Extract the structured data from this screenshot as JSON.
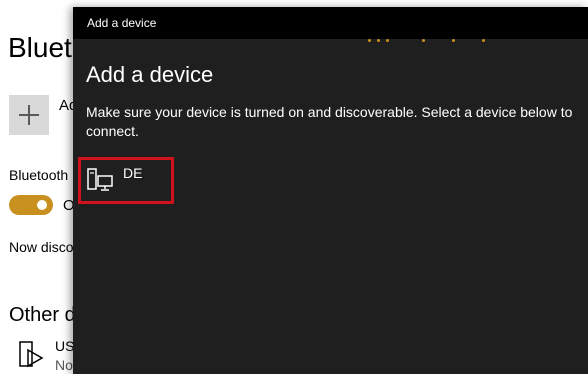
{
  "background": {
    "title": "Blueto",
    "add_text": "Ad",
    "bluetooth_label": "Bluetooth",
    "toggle_text": "O",
    "discover_text": "Now disco",
    "other_heading": "Other d",
    "device_name": "US",
    "device_status": "No"
  },
  "dialog": {
    "window_title": "Add a device",
    "heading": "Add a device",
    "instructions": "Make sure your device is turned on and discoverable. Select a device below to connect.",
    "devices": [
      {
        "name": "DE",
        "icon": "desktop-computer-icon"
      }
    ],
    "accent_color": "#c8911f",
    "highlight_color": "#d0121d"
  }
}
